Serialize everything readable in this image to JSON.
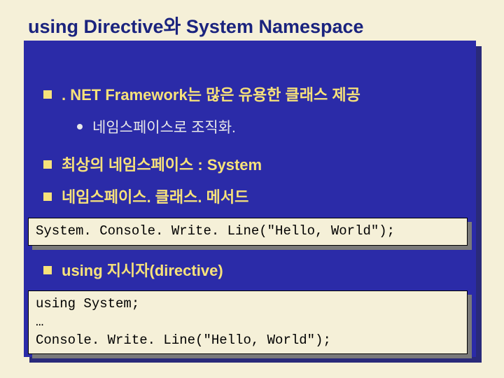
{
  "title": "using Directive와 System Namespace",
  "bullets": {
    "b1": ". NET Framework는 많은 유용한 클래스 제공",
    "sub1": "네임스페이스로 조직화.",
    "b2": "최상의 네임스페이스 : System",
    "b3": "네임스페이스. 클래스. 메서드",
    "b4": "using 지시자(directive)"
  },
  "code": {
    "c1": "System. Console. Write. Line(\"Hello, World\");",
    "c2": "using System;\n…\nConsole. Write. Line(\"Hello, World\");"
  }
}
